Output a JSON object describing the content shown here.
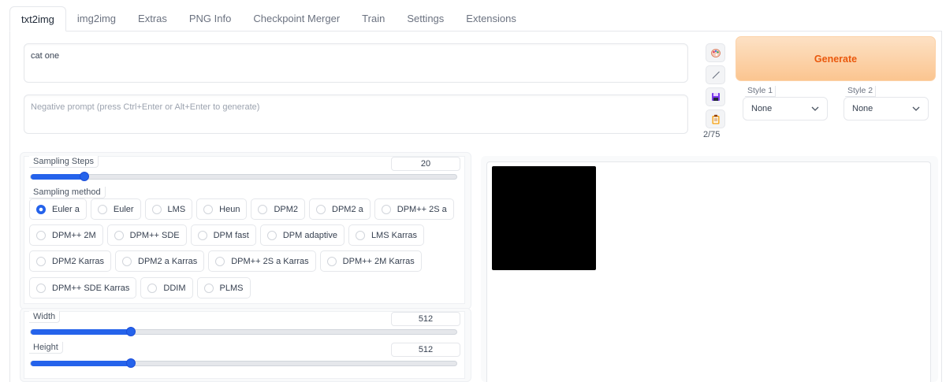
{
  "tabs": [
    "txt2img",
    "img2img",
    "Extras",
    "PNG Info",
    "Checkpoint Merger",
    "Train",
    "Settings",
    "Extensions"
  ],
  "active_tab": "txt2img",
  "prompt": {
    "value": "cat one"
  },
  "negative_prompt": {
    "placeholder": "Negative prompt (press Ctrl+Enter or Alt+Enter to generate)"
  },
  "tools": [
    {
      "name": "palette-icon",
      "glyph": "🎨"
    },
    {
      "name": "pencil-icon",
      "glyph": "⟋"
    },
    {
      "name": "save-icon",
      "glyph": "💾"
    },
    {
      "name": "clipboard-icon",
      "glyph": "📋"
    }
  ],
  "token_count": "2/75",
  "generate": {
    "label": "Generate"
  },
  "styles": [
    {
      "label": "Style 1",
      "value": "None"
    },
    {
      "label": "Style 2",
      "value": "None"
    }
  ],
  "sampling_steps": {
    "label": "Sampling Steps",
    "value": "20",
    "fraction": 0.1266
  },
  "sampling_method": {
    "label": "Sampling method",
    "selected": "Euler a",
    "rows": [
      [
        "Euler a",
        "Euler",
        "LMS",
        "Heun",
        "DPM2",
        "DPM2 a",
        "DPM++ 2S a"
      ],
      [
        "DPM++ 2M",
        "DPM++ SDE",
        "DPM fast",
        "DPM adaptive",
        "LMS Karras"
      ],
      [
        "DPM2 Karras",
        "DPM2 a Karras",
        "DPM++ 2S a Karras",
        "DPM++ 2M Karras"
      ],
      [
        "DPM++ SDE Karras",
        "DDIM",
        "PLMS"
      ]
    ]
  },
  "width": {
    "label": "Width",
    "value": "512",
    "fraction": 0.2353
  },
  "height": {
    "label": "Height",
    "value": "512",
    "fraction": 0.2353
  },
  "colors": {
    "accent": "#2563eb",
    "generate_text": "#ea580c",
    "generate_bg": "#fbc590",
    "output_image": "#000000"
  }
}
